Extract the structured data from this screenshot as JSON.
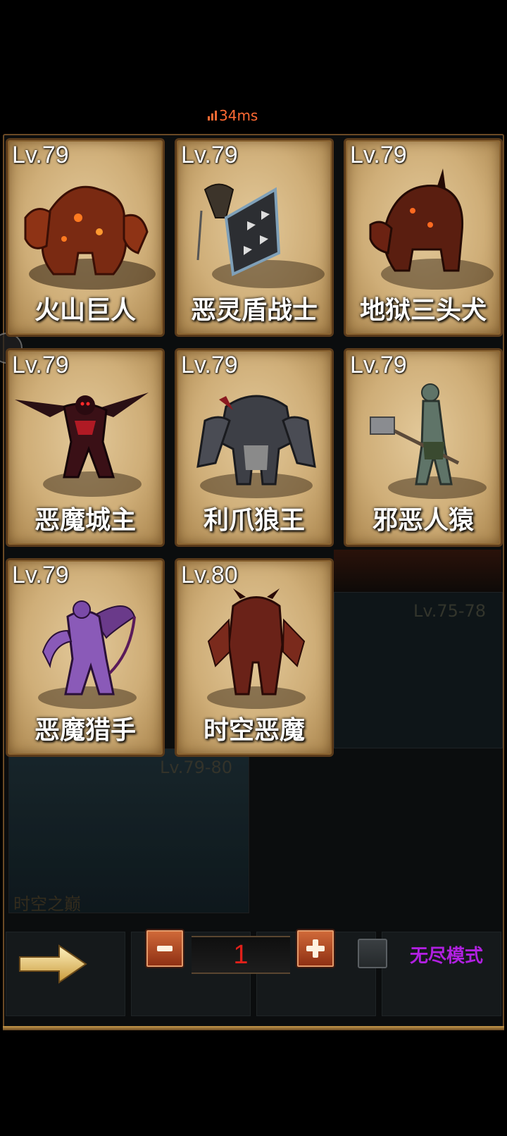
{
  "status": {
    "ping": "34ms",
    "ping_color": "#ff6a33"
  },
  "monsters": [
    {
      "level": "Lv.79",
      "name": "火山巨人",
      "icon": "volcano-giant-icon"
    },
    {
      "level": "Lv.79",
      "name": "恶灵盾战士",
      "icon": "shield-warrior-icon"
    },
    {
      "level": "Lv.79",
      "name": "地狱三头犬",
      "icon": "hellhound-icon"
    },
    {
      "level": "Lv.79",
      "name": "恶魔城主",
      "icon": "demon-lord-icon"
    },
    {
      "level": "Lv.79",
      "name": "利爪狼王",
      "icon": "wolf-king-icon"
    },
    {
      "level": "Lv.79",
      "name": "邪恶人猿",
      "icon": "evil-ape-icon"
    },
    {
      "level": "Lv.79",
      "name": "恶魔猎手",
      "icon": "demon-hunter-icon"
    },
    {
      "level": "Lv.80",
      "name": "时空恶魔",
      "icon": "timespace-demon-icon"
    }
  ],
  "background": {
    "card_level": "Lv.79-80",
    "card_name": "时空之巅",
    "right_level": "Lv.75-78"
  },
  "controls": {
    "count": "1",
    "endless_mode_label": "无尽模式",
    "endless_mode_checked": false,
    "mode_label_color": "#b020e0",
    "counter_color": "#e0201a"
  }
}
